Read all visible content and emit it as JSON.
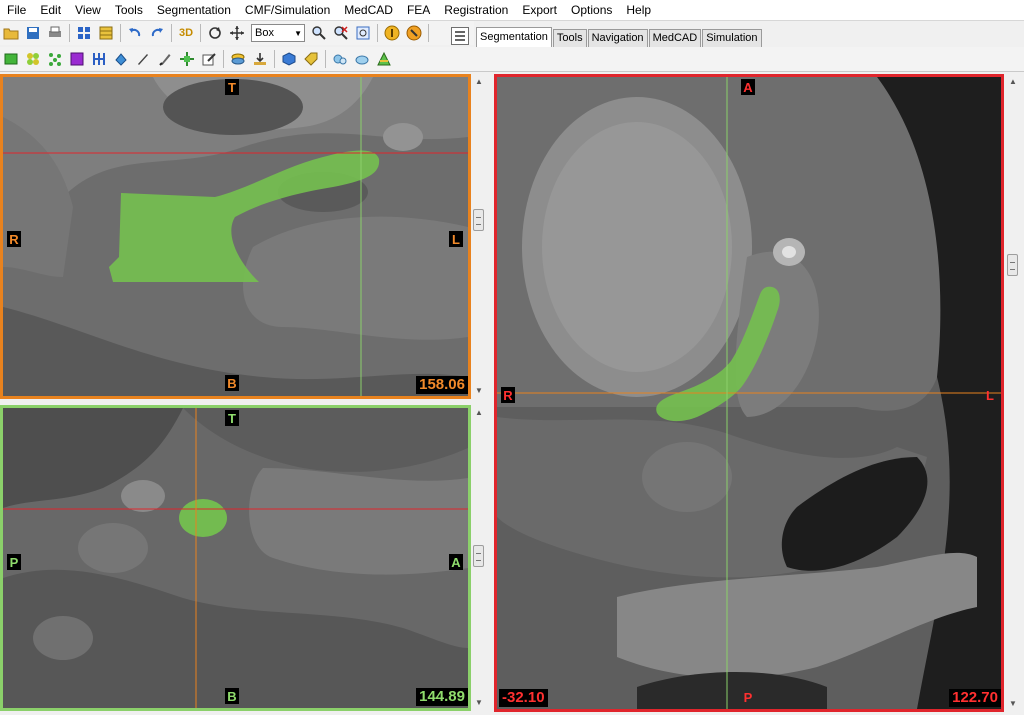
{
  "menu": [
    "File",
    "Edit",
    "View",
    "Tools",
    "Segmentation",
    "CMF/Simulation",
    "MedCAD",
    "FEA",
    "Registration",
    "Export",
    "Options",
    "Help"
  ],
  "toolbar": {
    "view_mode_value": "Box",
    "three_d_label": "3D"
  },
  "tabs": [
    "Segmentation",
    "Tools",
    "Navigation",
    "MedCAD",
    "Simulation"
  ],
  "active_tab": "Segmentation",
  "views": {
    "top": {
      "labels": {
        "top": "T",
        "bottom": "B",
        "left": "R",
        "right": "L"
      },
      "value": "158.06",
      "border_color": "#e8821e"
    },
    "bottom": {
      "labels": {
        "top": "T",
        "bottom": "B",
        "left": "P",
        "right": "A"
      },
      "value": "144.89",
      "border_color": "#8bd06a"
    },
    "right": {
      "labels": {
        "top": "A",
        "bottom": "P",
        "left": "R",
        "right": "L"
      },
      "value_left": "-32.10",
      "value_right": "122.70",
      "border_color": "#e0252c"
    }
  },
  "colors": {
    "segmentation": "#74c04f",
    "crosshair_red": "#e0252c",
    "crosshair_orange": "#e8821e",
    "crosshair_green": "#8bd06a"
  }
}
